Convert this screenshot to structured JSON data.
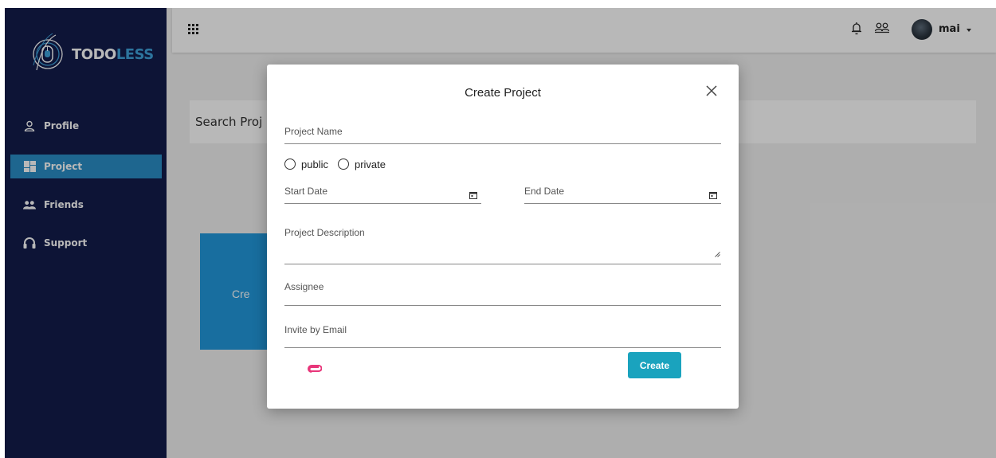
{
  "app": {
    "logo_part1": "TODO",
    "logo_part2": "LESS",
    "brand_color": "#3fa2dc"
  },
  "sidebar": {
    "items": [
      {
        "label": "Profile",
        "icon": "user-icon"
      },
      {
        "label": "Project",
        "icon": "dashboard-icon",
        "active": true
      },
      {
        "label": "Friends",
        "icon": "friends-icon"
      },
      {
        "label": "Support",
        "icon": "headset-icon"
      }
    ]
  },
  "header": {
    "user_name": "mai"
  },
  "background": {
    "search_label": "Search Proj",
    "create_card_label": "Cre"
  },
  "modal": {
    "title": "Create Project",
    "project_name_placeholder": "Project Name",
    "visibility_options": [
      "public",
      "private"
    ],
    "start_date_placeholder": "Start Date",
    "end_date_placeholder": "End Date",
    "description_placeholder": "Project Description",
    "assignee_placeholder": "Assignee",
    "invite_placeholder": "Invite by Email",
    "create_label": "Create",
    "accent_color": "#1aa3be",
    "attach_color": "#e8367a"
  }
}
